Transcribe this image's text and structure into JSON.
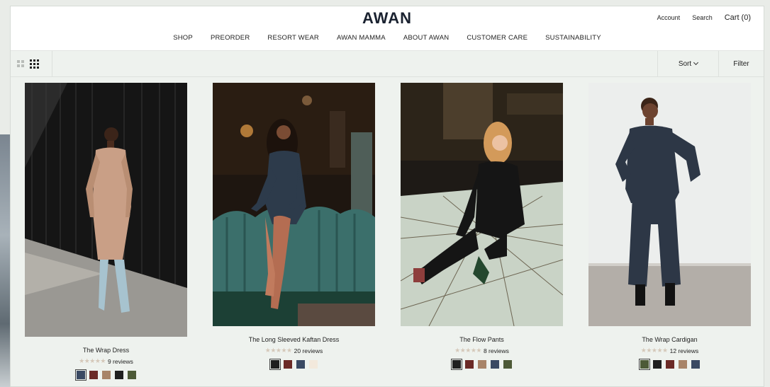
{
  "brand": {
    "logo": "AWAN"
  },
  "utility_nav": {
    "account": "Account",
    "search": "Search",
    "cart": "Cart (0)"
  },
  "main_nav": [
    "SHOP",
    "PREORDER",
    "RESORT WEAR",
    "AWAN MAMMA",
    "ABOUT AWAN",
    "CUSTOMER CARE",
    "SUSTAINABILITY"
  ],
  "toolbar": {
    "sort_label": "Sort",
    "filter_label": "Filter"
  },
  "products": [
    {
      "name": "The Wrap Dress",
      "stars": "★★★★★",
      "reviews": "9 reviews",
      "image": "woman in tan wrap dress and pale blue boots against black wood wall",
      "swatches": [
        "#3a4a63",
        "#6b2a26",
        "#a88468",
        "#1f1f1f",
        "#4d5a37"
      ]
    },
    {
      "name": "The Long Sleeved Kaftan Dress",
      "stars": "★★★★★",
      "reviews": "20 reviews",
      "image": "woman in dark kaftan dress on velvet couch",
      "swatches": [
        "#1f1f1f",
        "#6b2a26",
        "#3a4a63",
        "#f3e9dc"
      ]
    },
    {
      "name": "The Flow Pants",
      "stars": "★★★★★",
      "reviews": "8 reviews",
      "image": "woman in black outfit seated on patterned floor",
      "swatches": [
        "#1f1f1f",
        "#6b2a26",
        "#a88468",
        "#3a4a63",
        "#4d5a37"
      ]
    },
    {
      "name": "The Wrap Cardigan",
      "stars": "★★★★★",
      "reviews": "12 reviews",
      "image": "woman in navy wrap cardigan and wide pants on white background",
      "swatches": [
        "#4d5a37",
        "#1f1f1f",
        "#6b2a26",
        "#a88468",
        "#3a4a63"
      ]
    }
  ]
}
